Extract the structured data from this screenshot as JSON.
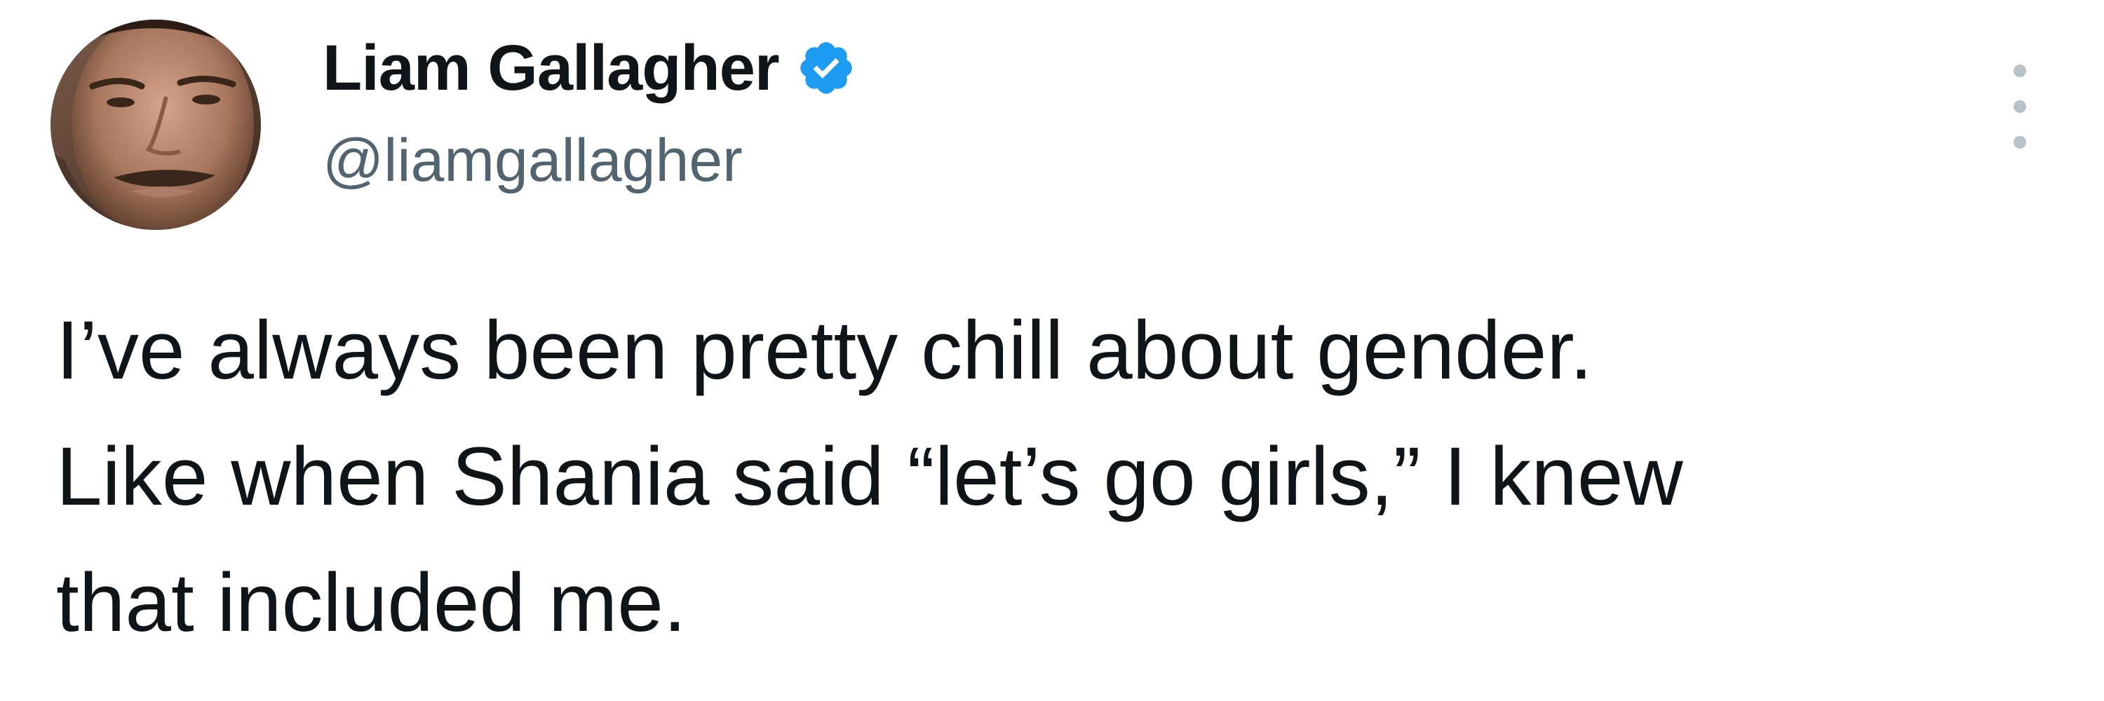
{
  "author": {
    "display_name": "Liam Gallagher",
    "handle": "@liamgallagher",
    "verified": true,
    "verified_icon": "verified-badge-icon",
    "avatar_icon": "profile-avatar",
    "verified_color": "#1d9bf0"
  },
  "menu": {
    "icon": "more-options-icon"
  },
  "tweet": {
    "lines": [
      "I’ve always been pretty chill about gender.",
      "Like when Shania said “let’s go girls,” I knew",
      "that included me."
    ]
  },
  "colors": {
    "text_primary": "#0f1419",
    "text_secondary": "#536471",
    "background": "#ffffff"
  }
}
